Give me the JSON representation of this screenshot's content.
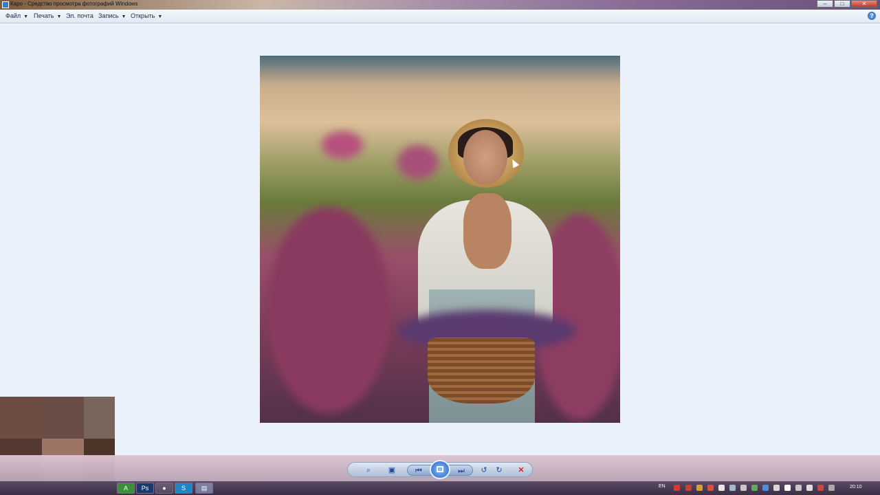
{
  "window": {
    "title": "Каро - Средство просмотра фотографий Windows",
    "buttons": {
      "minimize": "–",
      "maximize": "□",
      "close": "✕"
    }
  },
  "menu": {
    "items": [
      {
        "label": "Файл",
        "has_dropdown": true
      },
      {
        "label": "Печать",
        "has_dropdown": true
      },
      {
        "label": "Эл. почта",
        "has_dropdown": false
      },
      {
        "label": "Запись",
        "has_dropdown": true
      },
      {
        "label": "Открыть",
        "has_dropdown": true
      }
    ],
    "help": "?"
  },
  "photo": {
    "subject": "woman in a hat holding a wicker basket in a lavender field"
  },
  "controls": {
    "zoom": "⌕",
    "actual_size": "▣",
    "previous": "⏮",
    "slideshow": "▣",
    "next": "⏭",
    "rotate_left": "↺",
    "rotate_right": "↻",
    "delete": "✕"
  },
  "taskbar": {
    "apps": [
      "A",
      "Ps",
      "●",
      "S",
      "▤"
    ],
    "language": "EN",
    "time": "20:10"
  }
}
